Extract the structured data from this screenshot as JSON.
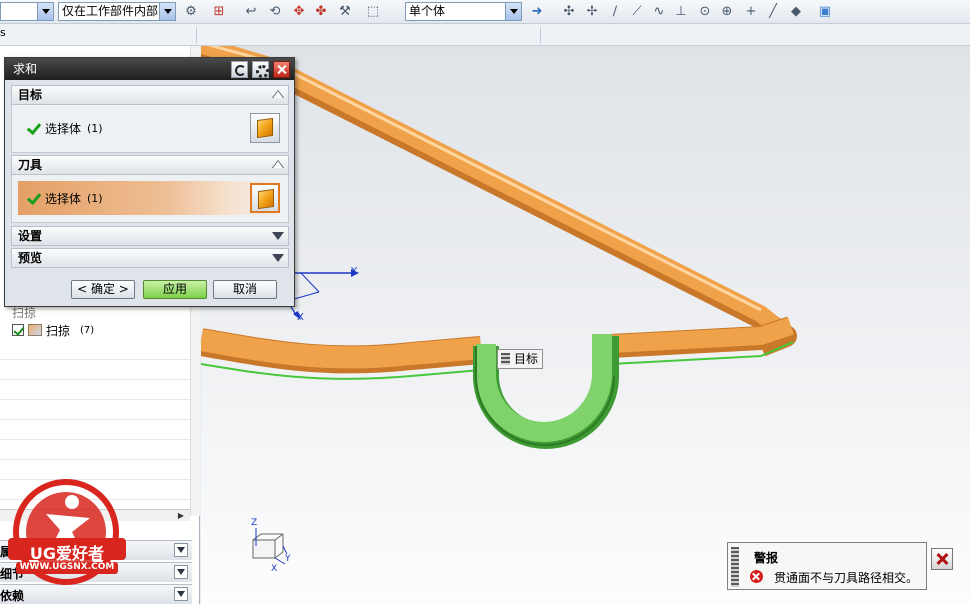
{
  "toolbar": {
    "filter_scope": "仅在工作部件内部",
    "selection_mode": "单个体",
    "icons": [
      "snap-icon",
      "undo-icon",
      "rotate-icon",
      "move-icon",
      "select-box-icon",
      "point-icon",
      "line-icon",
      "arc-icon",
      "circle-icon",
      "cross-icon",
      "cube-view-icon"
    ]
  },
  "navigator": {
    "left_edge_char": "s",
    "sweep_item": {
      "label": "扫掠",
      "count": "(7)"
    },
    "partial_item_label": "扫掠",
    "sections": [
      "属性",
      "细节",
      "依赖"
    ]
  },
  "dialog": {
    "title": "求和",
    "groups": {
      "target": {
        "heading": "目标",
        "select_label": "选择体",
        "select_count": "(1)"
      },
      "tool": {
        "heading": "刀具",
        "select_label": "选择体",
        "select_count": "(1)"
      },
      "settings": {
        "heading": "设置"
      },
      "preview": {
        "heading": "预览"
      }
    },
    "buttons": {
      "ok": "< 确定 >",
      "apply": "应用",
      "cancel": "取消"
    }
  },
  "viewport": {
    "target_tooltip": "目标",
    "wcs_axes": {
      "x": "X",
      "y": "Y",
      "z": "Z"
    },
    "colors": {
      "sweep": "#f0a24a",
      "highlight": "#46c83c",
      "tool_body": "#7fd36a"
    }
  },
  "warning": {
    "title": "警报",
    "message": "贯通面不与刀具路径相交。"
  },
  "logo": {
    "brand": "UG爱好者",
    "url": "WWW.UGSNX.COM"
  }
}
